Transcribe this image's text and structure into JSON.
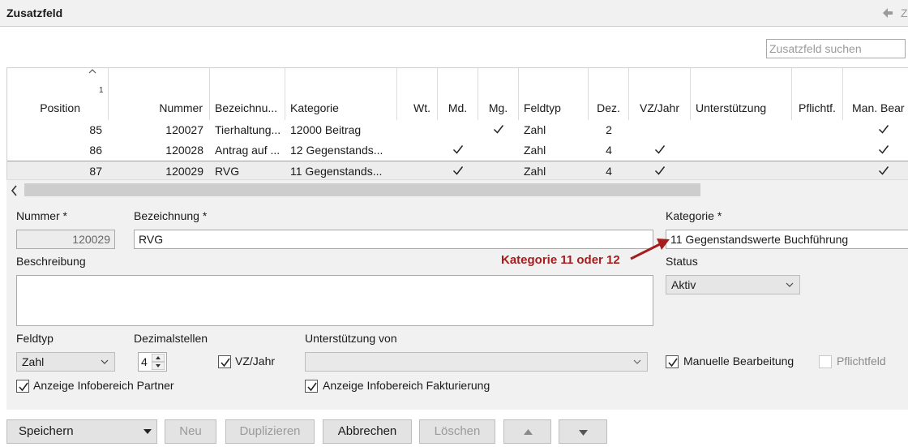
{
  "window": {
    "title": "Zusatzfeld",
    "back_text": "Z"
  },
  "search": {
    "placeholder": "Zusatzfeld suchen"
  },
  "table": {
    "sort_indicator": "1",
    "columns": [
      "Position",
      "Nummer",
      "Bezeichnu...",
      "Kategorie",
      "Wt.",
      "Md.",
      "Mg.",
      "Feldtyp",
      "Dez.",
      "VZ/Jahr",
      "Unterstützung",
      "Pflichtf.",
      "Man. Bear"
    ],
    "rows": [
      {
        "position": "85",
        "nummer": "120027",
        "bezeichnung": "Tierhaltung...",
        "kategorie": "12000 Beitrag",
        "wt": false,
        "md": false,
        "mg": true,
        "feldtyp": "Zahl",
        "dez": "2",
        "vz": false,
        "unterstuetzung": "",
        "pflicht": false,
        "man": true
      },
      {
        "position": "86",
        "nummer": "120028",
        "bezeichnung": "Antrag auf ...",
        "kategorie": "12 Gegenstands...",
        "wt": false,
        "md": true,
        "mg": false,
        "feldtyp": "Zahl",
        "dez": "4",
        "vz": true,
        "unterstuetzung": "",
        "pflicht": false,
        "man": true
      },
      {
        "position": "87",
        "nummer": "120029",
        "bezeichnung": "RVG",
        "kategorie": "11 Gegenstands...",
        "wt": false,
        "md": true,
        "mg": false,
        "feldtyp": "Zahl",
        "dez": "4",
        "vz": true,
        "unterstuetzung": "",
        "pflicht": false,
        "man": true
      }
    ]
  },
  "form": {
    "nummer_label": "Nummer *",
    "nummer_value": "120029",
    "bezeichnung_label": "Bezeichnung *",
    "bezeichnung_value": "RVG",
    "kategorie_label": "Kategorie *",
    "kategorie_value": "11  Gegenstandswerte Buchführung",
    "beschreibung_label": "Beschreibung",
    "beschreibung_value": "",
    "status_label": "Status",
    "status_value": "Aktiv",
    "feldtyp_label": "Feldtyp",
    "feldtyp_value": "Zahl",
    "dezimal_label": "Dezimalstellen",
    "dezimal_value": "4",
    "vzjahr_label": "VZ/Jahr",
    "vzjahr_checked": true,
    "unterstuetzung_label": "Unterstützung von",
    "unterstuetzung_value": "",
    "manuelle_label": "Manuelle Bearbeitung",
    "manuelle_checked": true,
    "pflichtfeld_label": "Pflichtfeld",
    "pflichtfeld_checked": false,
    "infopartner_label": "Anzeige Infobereich Partner",
    "infopartner_checked": true,
    "infofakt_label": "Anzeige Infobereich Fakturierung",
    "infofakt_checked": true
  },
  "annotation": {
    "text": "Kategorie 11 oder 12",
    "color": "#a51d1d"
  },
  "buttons": {
    "save": "Speichern",
    "new": "Neu",
    "duplicate": "Duplizieren",
    "cancel": "Abbrechen",
    "delete": "Löschen"
  }
}
